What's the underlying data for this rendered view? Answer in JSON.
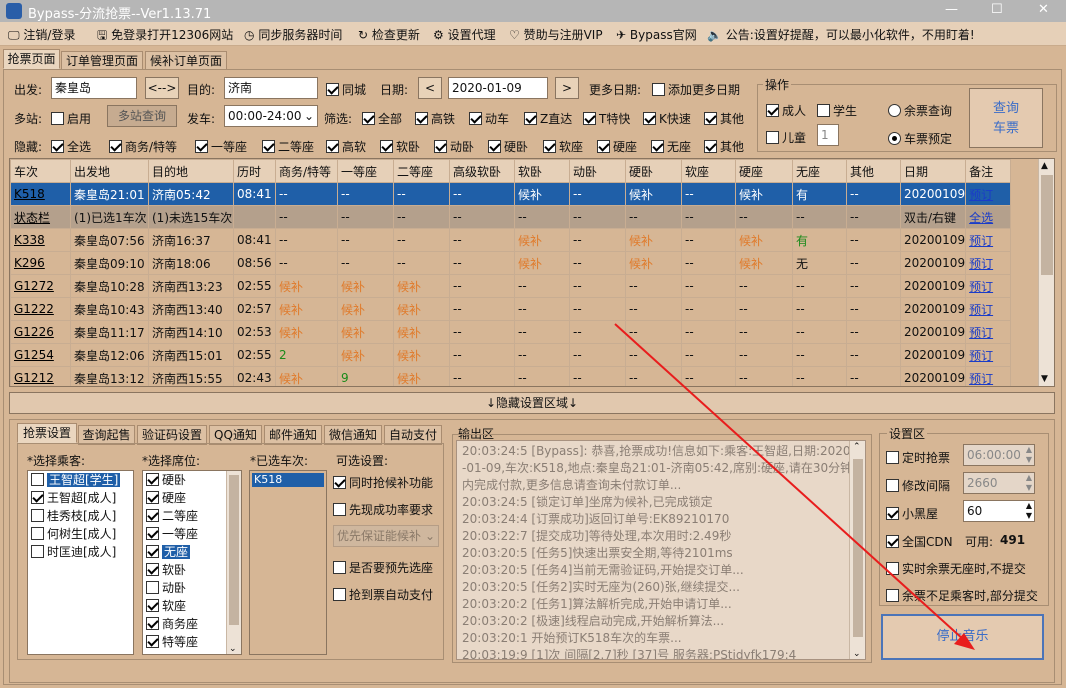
{
  "window": {
    "title": "Bypass-分流抢票--Ver1.13.71",
    "min": "—",
    "max": "☐",
    "close": "✕"
  },
  "menu": [
    {
      "icon": "monitor-icon",
      "glyph": "🖵",
      "label": "注销/登录"
    },
    {
      "icon": "disk-icon",
      "glyph": "🖫",
      "label": "免登录打开12306网站"
    },
    {
      "icon": "clock-icon",
      "glyph": "◷",
      "label": "同步服务器时间"
    },
    {
      "icon": "refresh-icon",
      "glyph": "↻",
      "label": "检查更新"
    },
    {
      "icon": "gear-icon",
      "glyph": "⚙",
      "label": "设置代理"
    },
    {
      "icon": "heart-icon",
      "glyph": "♡",
      "label": "赞助与注册VIP"
    },
    {
      "icon": "plane-icon",
      "glyph": "✈",
      "label": "Bypass官网"
    },
    {
      "icon": "speaker-icon",
      "glyph": "🔈",
      "label": "公告:设置好提醒，可以最小化软件，不用盯着!"
    }
  ],
  "main_tabs": [
    "抢票页面",
    "订单管理页面",
    "候补订单页面"
  ],
  "form": {
    "from_label": "出发:",
    "from": "秦皇岛",
    "swap": "<-->",
    "to_label": "目的:",
    "to": "济南",
    "same_city": "同城",
    "date_label": "日期:",
    "date": "2020-01-09",
    "prev": "<",
    "next": ">",
    "more_dates_label": "更多日期:",
    "add_more_dates": "添加更多日期",
    "multi_label": "多站:",
    "enable": "启用",
    "multi_query": "多站查询",
    "depart_label": "发车:",
    "depart_time": "00:00-24:00",
    "filter_label": "筛选:",
    "filters": [
      {
        "label": "全部",
        "on": true
      },
      {
        "label": "高铁",
        "on": true
      },
      {
        "label": "动车",
        "on": true
      },
      {
        "label": "Z直达",
        "on": true
      },
      {
        "label": "T特快",
        "on": true
      },
      {
        "label": "K快速",
        "on": true
      },
      {
        "label": "其他",
        "on": true
      }
    ],
    "hide_label": "隐藏:",
    "hides": [
      {
        "label": "全选",
        "on": true
      },
      {
        "label": "商务/特等",
        "on": true
      },
      {
        "label": "一等座",
        "on": true
      },
      {
        "label": "二等座",
        "on": true
      },
      {
        "label": "高软",
        "on": true
      },
      {
        "label": "软卧",
        "on": true
      },
      {
        "label": "动卧",
        "on": true
      },
      {
        "label": "硬卧",
        "on": true
      },
      {
        "label": "软座",
        "on": true
      },
      {
        "label": "硬座",
        "on": true
      },
      {
        "label": "无座",
        "on": true
      },
      {
        "label": "其他",
        "on": true
      }
    ]
  },
  "ops": {
    "title": "操作",
    "adult": "成人",
    "student": "学生",
    "child": "儿童",
    "child_count": "1",
    "remain_query": "余票查询",
    "reserve": "车票预定",
    "query_button": "查询\n车票"
  },
  "table": {
    "headers": [
      "车次",
      "出发地",
      "目的地",
      "历时",
      "商务/特等",
      "一等座",
      "二等座",
      "高级软卧",
      "软卧",
      "动卧",
      "硬卧",
      "软座",
      "硬座",
      "无座",
      "其他",
      "日期",
      "备注"
    ],
    "rows": [
      [
        "K518",
        "秦皇岛21:01",
        "济南05:42",
        "08:41",
        "--",
        "--",
        "--",
        "--",
        "候补",
        "--",
        "候补",
        "--",
        "候补",
        "有",
        "--",
        "20200109",
        "预订"
      ],
      [
        "状态栏",
        "(1)已选1车次",
        "(1)未选15车次",
        "",
        "--",
        "--",
        "--",
        "--",
        "--",
        "--",
        "--",
        "--",
        "--",
        "--",
        "--",
        "双击/右键",
        "全选"
      ],
      [
        "K338",
        "秦皇岛07:56",
        "济南16:37",
        "08:41",
        "--",
        "--",
        "--",
        "--",
        "候补",
        "--",
        "候补",
        "--",
        "候补",
        "有",
        "--",
        "20200109",
        "预订"
      ],
      [
        "K296",
        "秦皇岛09:10",
        "济南18:06",
        "08:56",
        "--",
        "--",
        "--",
        "--",
        "候补",
        "--",
        "候补",
        "--",
        "候补",
        "无",
        "--",
        "20200109",
        "预订"
      ],
      [
        "G1272",
        "秦皇岛10:28",
        "济南西13:23",
        "02:55",
        "候补",
        "候补",
        "候补",
        "--",
        "--",
        "--",
        "--",
        "--",
        "--",
        "--",
        "--",
        "20200109",
        "预订"
      ],
      [
        "G1222",
        "秦皇岛10:43",
        "济南西13:40",
        "02:57",
        "候补",
        "候补",
        "候补",
        "--",
        "--",
        "--",
        "--",
        "--",
        "--",
        "--",
        "--",
        "20200109",
        "预订"
      ],
      [
        "G1226",
        "秦皇岛11:17",
        "济南西14:10",
        "02:53",
        "候补",
        "候补",
        "候补",
        "--",
        "--",
        "--",
        "--",
        "--",
        "--",
        "--",
        "--",
        "20200109",
        "预订"
      ],
      [
        "G1254",
        "秦皇岛12:06",
        "济南西15:01",
        "02:55",
        "2",
        "候补",
        "候补",
        "--",
        "--",
        "--",
        "--",
        "--",
        "--",
        "--",
        "--",
        "20200109",
        "预订"
      ],
      [
        "G1212",
        "秦皇岛13:12",
        "济南西15:55",
        "02:43",
        "候补",
        "9",
        "候补",
        "--",
        "--",
        "--",
        "--",
        "--",
        "--",
        "--",
        "--",
        "20200109",
        "预订"
      ]
    ]
  },
  "hide_settings": "↓隐藏设置区域↓",
  "sub_tabs": [
    "抢票设置",
    "查询起售",
    "验证码设置",
    "QQ通知",
    "邮件通知",
    "微信通知",
    "自动支付"
  ],
  "passengers": {
    "title": "*选择乘客:",
    "items": [
      {
        "label": "王智超[学生]",
        "on": false,
        "hl": true
      },
      {
        "label": "王智超[成人]",
        "on": true
      },
      {
        "label": "桂秀枝[成人]",
        "on": false
      },
      {
        "label": "何树生[成人]",
        "on": false
      },
      {
        "label": "时匡迪[成人]",
        "on": false
      }
    ]
  },
  "seats": {
    "title": "*选择席位:",
    "items": [
      {
        "label": "硬卧",
        "on": true
      },
      {
        "label": "硬座",
        "on": true
      },
      {
        "label": "二等座",
        "on": true
      },
      {
        "label": "一等座",
        "on": true
      },
      {
        "label": "无座",
        "on": true,
        "hl": true
      },
      {
        "label": "软卧",
        "on": true
      },
      {
        "label": "动卧",
        "on": false
      },
      {
        "label": "软座",
        "on": true
      },
      {
        "label": "商务座",
        "on": true
      },
      {
        "label": "特等座",
        "on": true
      }
    ]
  },
  "trains": {
    "title": "*已选车次:",
    "items": [
      "K518"
    ]
  },
  "options": {
    "title": "可选设置:",
    "waitlist": "同时抢候补功能",
    "success_rate": "先现成功率要求",
    "priority": "优先保证能候补",
    "ask_first": "是否要预先选座",
    "auto_pay": "抢到票自动支付"
  },
  "output": {
    "title": "输出区",
    "lines": [
      "20:03:24:5  [Bypass]: 恭喜,抢票成功!信息如下:乘客:王智超,日期:2020",
      "-01-09,车次:K518,地点:秦皇岛21:01-济南05:42,席别:硬座,请在30分钟",
      "内完成付款,更多信息请查询未付款订单...",
      "20:03:24:5  [锁定订单]坐席为候补,已完成锁定",
      "20:03:24:4  [订票成功]返回订单号:EK89210170",
      "20:03:22:7  [提交成功]等待处理,本次用时:2.49秒",
      "20:03:20:5  [任务5]快速出票安全期,等待2101ms",
      "20:03:20:5  [任务4]当前无需验证码,开始提交订单...",
      "20:03:20:5  [任务2]实时无座为(260)张,继续提交...",
      "20:03:20:2  [任务1]算法解析完成,开始申请订单...",
      "20:03:20:2  [极速]线程启动完成,开始解析算法...",
      "20:03:20:1  开始预订K518车次的车票...",
      "20:03:19:9  [1]次 间隔[2.7]秒 [37]号 服务器:PStidyfk179:4"
    ]
  },
  "settings": {
    "title": "设置区",
    "timed": "定时抢票",
    "timed_val": "06:00:00",
    "modify": "修改间隔",
    "modify_val": "2660",
    "blackroom": "小黑屋",
    "blackroom_val": "60",
    "cdn": "全国CDN",
    "cdn_avail": "可用:",
    "cdn_count": "491",
    "realtime": "实时余票无座时,不提交",
    "partial": "余票不足乘客时,部分提交",
    "stop_music": "停止音乐"
  }
}
